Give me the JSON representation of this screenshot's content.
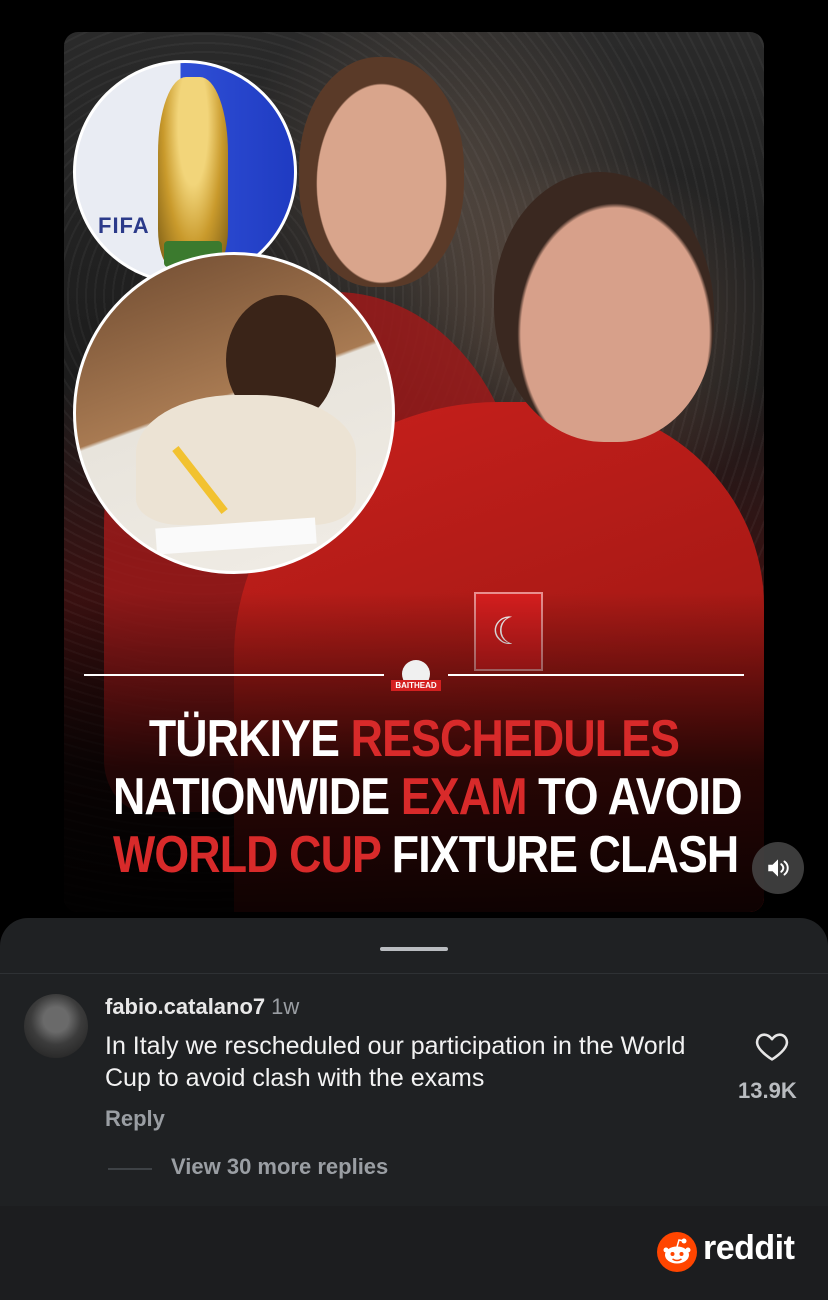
{
  "post": {
    "headline": {
      "line1": [
        "TÜRKIYE ",
        "RESCHEDULES"
      ],
      "line2": [
        "NATIONWIDE ",
        "EXAM",
        " TO AVOID"
      ],
      "line3": [
        "WORLD CUP",
        " FIXTURE CLASH"
      ]
    },
    "fifa_label": "FIFA",
    "logo_label": "BAITHEAD",
    "sound_icon": "speaker-icon"
  },
  "comment": {
    "username": "fabio.catalano7",
    "time": "1w",
    "text": "In Italy we rescheduled our participation in the World Cup to avoid clash with the exams",
    "reply_label": "Reply",
    "like_count": "13.9K",
    "view_more": "View 30 more replies"
  },
  "footer": {
    "brand": "reddit"
  },
  "colors": {
    "accent_red": "#d82a2a",
    "sheet_bg": "#1f2123",
    "reddit_orange": "#ff4500"
  }
}
